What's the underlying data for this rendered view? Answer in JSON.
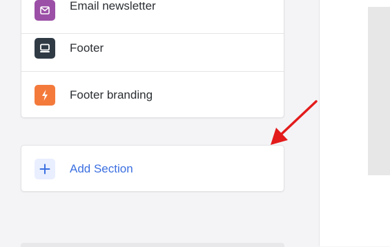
{
  "sections": [
    {
      "label": "Email newsletter",
      "icon": "email-icon",
      "icon_bg": "#9b4fa6"
    },
    {
      "label": "Footer",
      "icon": "footer-icon",
      "icon_bg": "#2f3a45"
    },
    {
      "label": "Footer branding",
      "icon": "lightning-icon",
      "icon_bg": "#f47a3b"
    }
  ],
  "add_section": {
    "label": "Add Section",
    "icon": "plus-icon",
    "accent": "#3b6fe0"
  },
  "annotation": {
    "icon": "red-arrow-icon",
    "color": "#e31b1b"
  }
}
